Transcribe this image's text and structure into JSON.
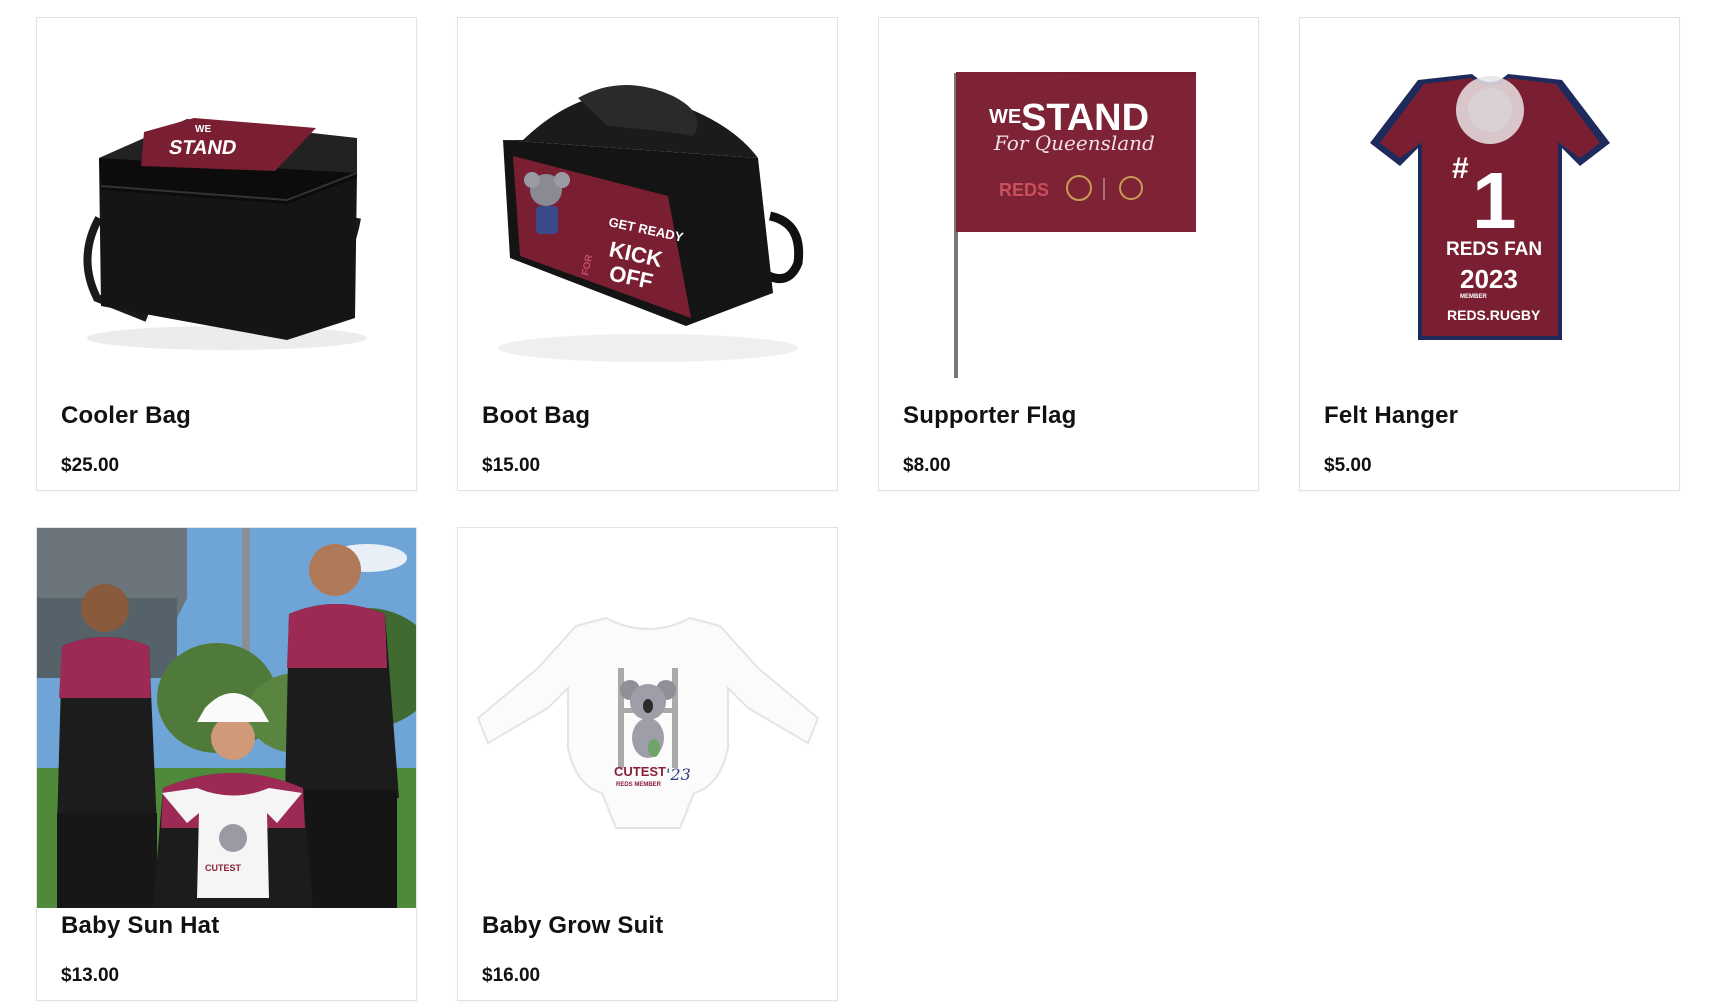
{
  "colors": {
    "maroon": "#7a1f32",
    "accent_pink": "#a32a58",
    "text": "#111111"
  },
  "products": [
    {
      "name": "Cooler Bag",
      "price": "$25.00",
      "image": "cooler-bag-image"
    },
    {
      "name": "Boot Bag",
      "price": "$15.00",
      "image": "boot-bag-image"
    },
    {
      "name": "Supporter Flag",
      "price": "$8.00",
      "image": "supporter-flag-image"
    },
    {
      "name": "Felt Hanger",
      "price": "$5.00",
      "image": "felt-hanger-image"
    },
    {
      "name": "Baby Sun Hat",
      "price": "$13.00",
      "image": "baby-sun-hat-photo"
    },
    {
      "name": "Baby Grow Suit",
      "price": "$16.00",
      "image": "baby-grow-suit-image"
    }
  ],
  "image_text": {
    "we": "WE",
    "stand": "STAND",
    "for_queensland": "For Queensland",
    "reds": "REDS",
    "get_ready": "GET READY",
    "for": "FOR",
    "kick": "KICK",
    "off": "OFF",
    "hash": "#",
    "one": "1",
    "reds_fan": "REDS FAN",
    "year": "2023",
    "member": "MEMBER",
    "reds_rugby": "REDS.RUGBY",
    "cutest": "CUTEST",
    "reds_member": "REDS MEMBER",
    "year_short": "'23"
  }
}
